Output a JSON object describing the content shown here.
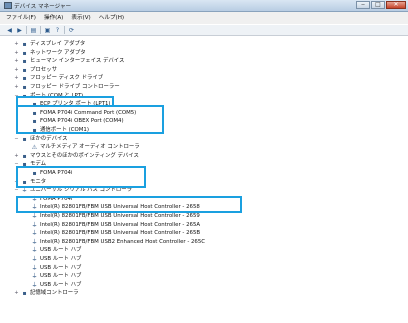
{
  "window": {
    "title": "デバイス マネージャー",
    "buttons": [
      "‒",
      "□",
      "✕"
    ]
  },
  "menu": [
    "ファイル(F)",
    "操作(A)",
    "表示(V)",
    "ヘルプ(H)"
  ],
  "toolbar": [
    "back-icon",
    "forward-icon",
    "view-icon",
    "properties-icon",
    "help-icon",
    "scan-icon"
  ],
  "tree": [
    {
      "label": "ディスプレイ アダプタ",
      "level": 0,
      "exp": "+",
      "icon": "display-icon"
    },
    {
      "label": "ネットワーク アダプタ",
      "level": 0,
      "exp": "+",
      "icon": "network-icon"
    },
    {
      "label": "ヒューマン インターフェイス デバイス",
      "level": 0,
      "exp": "+",
      "icon": "hid-icon"
    },
    {
      "label": "プロセッサ",
      "level": 0,
      "exp": "+",
      "icon": "cpu-icon"
    },
    {
      "label": "フロッピー ディスク ドライブ",
      "level": 0,
      "exp": "+",
      "icon": "floppy-icon"
    },
    {
      "label": "フロッピー ドライブ コントローラー",
      "level": 0,
      "exp": "+",
      "icon": "controller-icon"
    },
    {
      "label": "ポート (COM と LPT)",
      "level": 0,
      "exp": "−",
      "icon": "port-icon"
    },
    {
      "label": "ECP プリンタ ポート (LPT1)",
      "level": 1,
      "exp": "",
      "icon": "port-icon"
    },
    {
      "label": "FOMA P704i Command Port (COM5)",
      "level": 1,
      "exp": "",
      "icon": "port-icon"
    },
    {
      "label": "FOMA P704i OBEX Port (COM4)",
      "level": 1,
      "exp": "",
      "icon": "port-icon"
    },
    {
      "label": "通信ポート (COM1)",
      "level": 1,
      "exp": "",
      "icon": "port-icon"
    },
    {
      "label": "ほかのデバイス",
      "level": 0,
      "exp": "−",
      "icon": "other-device-icon"
    },
    {
      "label": "マルチメディア オーディオ コントローラ",
      "level": 1,
      "exp": "",
      "icon": "warning-icon"
    },
    {
      "label": "マウスとそのほかのポインティング デバイス",
      "level": 0,
      "exp": "+",
      "icon": "mouse-icon"
    },
    {
      "label": "モデム",
      "level": 0,
      "exp": "−",
      "icon": "modem-icon"
    },
    {
      "label": "FOMA P704i",
      "level": 1,
      "exp": "",
      "icon": "modem-icon"
    },
    {
      "label": "モニタ",
      "level": 0,
      "exp": "+",
      "icon": "monitor-icon"
    },
    {
      "label": "ユニバーサル シリアル バス コントローラ",
      "level": 0,
      "exp": "−",
      "icon": "usb-icon"
    },
    {
      "label": "FOMA P704i",
      "level": 1,
      "exp": "",
      "icon": "usb-icon"
    },
    {
      "label": "Intel(R) 82801FB/FBM USB Universal Host Controller - 2658",
      "level": 1,
      "exp": "",
      "icon": "usb-icon"
    },
    {
      "label": "Intel(R) 82801FB/FBM USB Universal Host Controller - 2659",
      "level": 1,
      "exp": "",
      "icon": "usb-icon"
    },
    {
      "label": "Intel(R) 82801FB/FBM USB Universal Host Controller - 265A",
      "level": 1,
      "exp": "",
      "icon": "usb-icon"
    },
    {
      "label": "Intel(R) 82801FB/FBM USB Universal Host Controller - 265B",
      "level": 1,
      "exp": "",
      "icon": "usb-icon"
    },
    {
      "label": "Intel(R) 82801FB/FBM USB2 Enhanced Host Controller - 265C",
      "level": 1,
      "exp": "",
      "icon": "usb-icon"
    },
    {
      "label": "USB ルート ハブ",
      "level": 1,
      "exp": "",
      "icon": "usb-icon"
    },
    {
      "label": "USB ルート ハブ",
      "level": 1,
      "exp": "",
      "icon": "usb-icon"
    },
    {
      "label": "USB ルート ハブ",
      "level": 1,
      "exp": "",
      "icon": "usb-icon"
    },
    {
      "label": "USB ルート ハブ",
      "level": 1,
      "exp": "",
      "icon": "usb-icon"
    },
    {
      "label": "USB ルート ハブ",
      "level": 1,
      "exp": "",
      "icon": "usb-icon"
    },
    {
      "label": "記憶域コントローラ",
      "level": 0,
      "exp": "+",
      "icon": "storage-icon"
    }
  ],
  "colors": {
    "highlight": "#1aa0e0",
    "titlebar": "#b8cde3"
  }
}
